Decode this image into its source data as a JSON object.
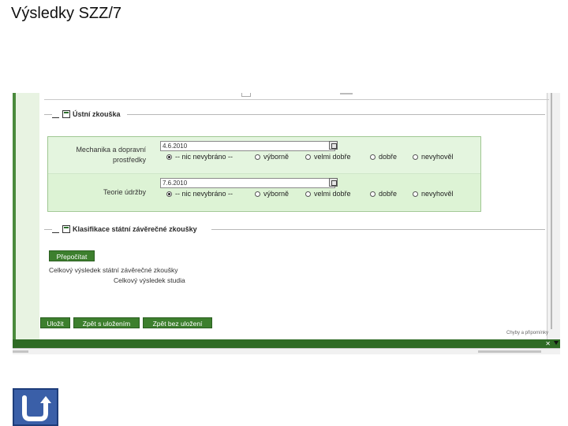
{
  "slide": {
    "title": "Výsledky SZZ/7"
  },
  "accent_color": "#3d7f2e",
  "panel_color": "#e4f5df",
  "oral_exam": {
    "legend": "Ústní zkouška",
    "rows": [
      {
        "label_line1": "Mechanika a dopravní",
        "label_line2": "prostředky",
        "date": "4.6.2010",
        "options": [
          "-- nic nevybráno --",
          "výborně",
          "velmi dobře",
          "dobře",
          "nevyhověl"
        ],
        "selected": "-- nic nevybráno --"
      },
      {
        "label_line1": "Teorie údržby",
        "label_line2": "",
        "date": "7.6.2010",
        "options": [
          "-- nic nevybráno --",
          "výborně",
          "velmi dobře",
          "dobře",
          "nevyhověl"
        ],
        "selected": "-- nic nevybráno --"
      }
    ]
  },
  "classification": {
    "legend": "Klasifikace státní závěrečné zkoušky",
    "recalc_button": "Přepočítat",
    "total_exam_label": "Celkový výsledek státní závěrečné zkoušky",
    "total_study_label": "Celkový výsledek studia"
  },
  "actions": {
    "save": "Uložit",
    "back_with_save": "Zpět s uložením",
    "back_without_save": "Zpět bez uložení"
  },
  "footer": {
    "errors_note": "Chyby a připomínky"
  },
  "icons": {
    "back": "u-turn-arrow-icon",
    "calendar": "calendar-icon",
    "collapse": "collapse-icon"
  }
}
